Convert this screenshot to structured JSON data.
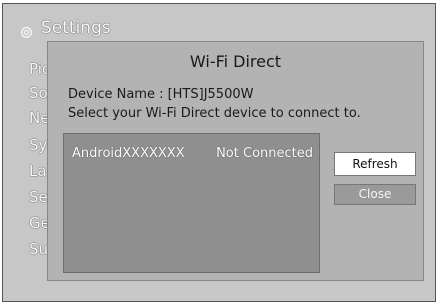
{
  "settings": {
    "title": "Settings",
    "menu": [
      "Pic",
      "So",
      "Ne",
      "Sy",
      "La",
      "Se",
      "Ge",
      "Su"
    ]
  },
  "dialog": {
    "title": "Wi-Fi Direct",
    "device_name_label": "Device Name : [HTS]J5500W",
    "instruction": "Select your Wi-Fi Direct device to connect to.",
    "devices": [
      {
        "name": "AndroidXXXXXXX",
        "status": "Not Connected"
      }
    ],
    "refresh_label": "Refresh",
    "close_label": "Close"
  }
}
